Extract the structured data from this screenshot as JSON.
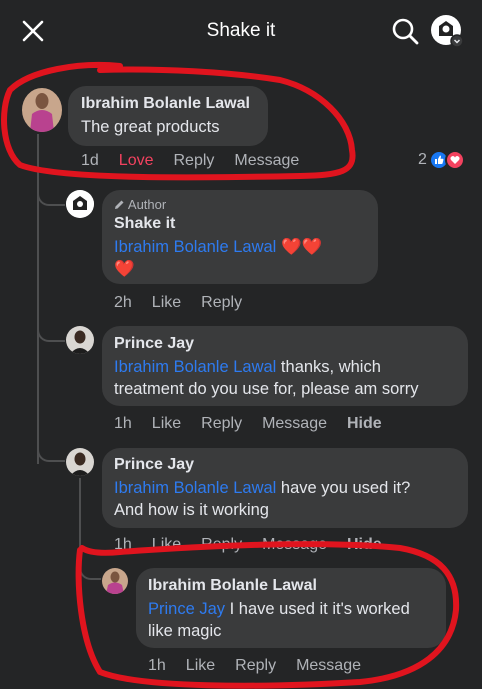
{
  "header": {
    "title": "Shake it"
  },
  "comment_main": {
    "author": "Ibrahim Bolanle Lawal",
    "text": "The great products",
    "time": "1d",
    "like_state": "Love",
    "reply": "Reply",
    "message": "Message",
    "reaction_count": "2"
  },
  "replies": [
    {
      "badge": "Author",
      "author": "Shake it",
      "mention": "Ibrahim Bolanle Lawal",
      "text": "❤️❤️",
      "text2": "❤️",
      "time": "2h",
      "like": "Like",
      "reply": "Reply"
    },
    {
      "author": "Prince Jay",
      "mention": "Ibrahim Bolanle Lawal",
      "text": " thanks, which",
      "text2": "treatment do you use for, please am sorry",
      "time": "1h",
      "like": "Like",
      "reply": "Reply",
      "message": "Message",
      "hide": "Hide"
    },
    {
      "author": "Prince Jay",
      "mention": "Ibrahim Bolanle Lawal",
      "text": " have you used it?",
      "text2": "And how is it working",
      "time": "1h",
      "like": "Like",
      "reply": "Reply",
      "message": "Message",
      "hide": "Hide"
    },
    {
      "author": "Ibrahim Bolanle Lawal",
      "mention": "Prince Jay",
      "text": " I have used it it's worked",
      "text2": "like magic",
      "time": "1h",
      "like": "Like",
      "reply": "Reply",
      "message": "Message"
    }
  ],
  "icons": {
    "close": "close-icon",
    "search": "search-icon",
    "profile": "page-avatar-icon",
    "like_reaction": "thumbs-up-icon",
    "love_reaction": "heart-icon",
    "author_badge": "pencil-icon"
  },
  "colors": {
    "background": "#242526",
    "bubble": "#3a3b3c",
    "mention": "#2e7bf0",
    "love": "#f3425f",
    "annotation": "#e0141e"
  }
}
